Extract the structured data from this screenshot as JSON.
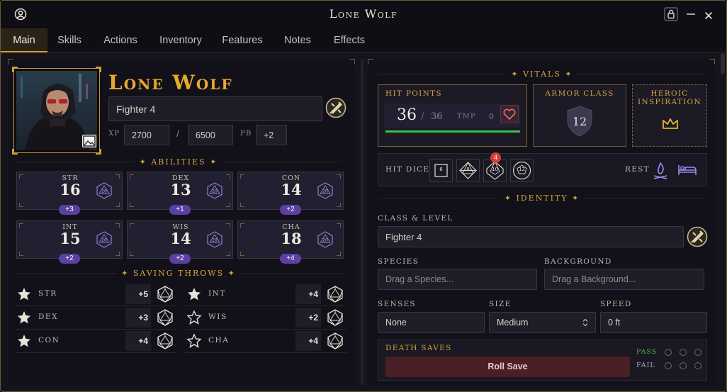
{
  "window": {
    "title": "Lone Wolf"
  },
  "tabs": [
    {
      "label": "Main"
    },
    {
      "label": "Skills"
    },
    {
      "label": "Actions"
    },
    {
      "label": "Inventory"
    },
    {
      "label": "Features"
    },
    {
      "label": "Notes"
    },
    {
      "label": "Effects"
    }
  ],
  "character": {
    "name": "Lone Wolf",
    "class_level": "Fighter 4",
    "xp_label": "XP",
    "xp": "2700",
    "xp_sep": "/",
    "xp_next": "6500",
    "pb_label": "PB",
    "pb": "+2"
  },
  "abilities": {
    "header": "✦ ABILITIES ✦",
    "items": [
      {
        "abbr": "STR",
        "score": "16",
        "mod": "+3",
        "die": "20"
      },
      {
        "abbr": "DEX",
        "score": "13",
        "mod": "+1",
        "die": "20"
      },
      {
        "abbr": "CON",
        "score": "14",
        "mod": "+2",
        "die": "20"
      },
      {
        "abbr": "INT",
        "score": "15",
        "mod": "+2",
        "die": "20"
      },
      {
        "abbr": "WIS",
        "score": "14",
        "mod": "+2",
        "die": "20"
      },
      {
        "abbr": "CHA",
        "score": "18",
        "mod": "+4",
        "die": "20"
      }
    ]
  },
  "saving_throws": {
    "header": "✦ SAVING THROWS ✦",
    "items": [
      {
        "abbr": "STR",
        "value": "+5",
        "proficient": true
      },
      {
        "abbr": "DEX",
        "value": "+3",
        "proficient": true
      },
      {
        "abbr": "CON",
        "value": "+4",
        "proficient": true
      },
      {
        "abbr": "INT",
        "value": "+4",
        "proficient": true
      },
      {
        "abbr": "WIS",
        "value": "+2",
        "proficient": false
      },
      {
        "abbr": "CHA",
        "value": "+4",
        "proficient": false
      }
    ]
  },
  "vitals": {
    "header": "✦ VITALS ✦",
    "hp_label": "HIT POINTS",
    "hp_current": "36",
    "hp_sep": "/",
    "hp_max": "36",
    "tmp_label": "TMP",
    "tmp": "0",
    "hp_fraction": 1.0,
    "ac_label": "ARMOR CLASS",
    "ac": "12",
    "inspiration_label": "HEROIC INSPIRATION",
    "hit_dice_label": "HIT DICE",
    "hit_dice": [
      {
        "label": "6"
      },
      {
        "label": "8"
      },
      {
        "label": "10",
        "badge": "4"
      },
      {
        "label": "12"
      }
    ],
    "rest_label": "REST"
  },
  "identity": {
    "header": "✦ IDENTITY ✦",
    "class_label": "CLASS & LEVEL",
    "class_value": "Fighter 4",
    "species_label": "SPECIES",
    "species_placeholder": "Drag a Species...",
    "background_label": "BACKGROUND",
    "background_placeholder": "Drag a Background...",
    "senses_label": "SENSES",
    "senses_value": "None",
    "size_label": "SIZE",
    "size_value": "Medium",
    "speed_label": "SPEED",
    "speed_value": "0 ft"
  },
  "death_saves": {
    "label": "DEATH SAVES",
    "button": "Roll Save",
    "pass_label": "PASS",
    "fail_label": "FAIL",
    "pass_count": 0,
    "fail_count": 0
  },
  "colors": {
    "accent_gold": "#d6a32a",
    "purple": "#5b3fa1",
    "hp_bar": "#3fbf4a",
    "pass_green": "#4caf50",
    "roll_red": "#4a1f26"
  }
}
